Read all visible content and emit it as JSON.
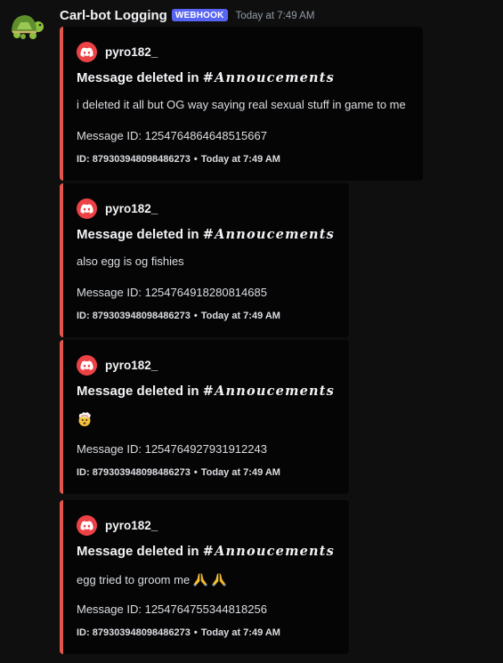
{
  "message": {
    "author": "Carl-bot Logging",
    "badge": "WEBHOOK",
    "timestamp": "Today at 7:49 AM",
    "avatar_icon": "turtle-avatar-icon"
  },
  "accent_color": "#e2574c",
  "embeds": [
    {
      "author": "pyro182_",
      "title_prefix": "Message deleted in ",
      "channel": "#𝑨𝒏𝒏𝒐𝒖𝒄𝒆𝒎𝒆𝒏𝒕𝒔",
      "description": "i deleted it all but OG way saying real sexual stuff in game to me",
      "emojis": [],
      "message_id_text": "Message ID: 1254764864648515667",
      "footer_id": "ID: 879303948098486273",
      "footer_sep": "•",
      "footer_time": "Today at 7:49 AM"
    },
    {
      "author": "pyro182_",
      "title_prefix": "Message deleted in ",
      "channel": "#𝑨𝒏𝒏𝒐𝒖𝒄𝒆𝒎𝒆𝒏𝒕𝒔",
      "description": "also egg is og fishies",
      "emojis": [],
      "message_id_text": "Message ID: 1254764918280814685",
      "footer_id": "ID: 879303948098486273",
      "footer_sep": "•",
      "footer_time": "Today at 7:49 AM"
    },
    {
      "author": "pyro182_",
      "title_prefix": "Message deleted in ",
      "channel": "#𝑨𝒏𝒏𝒐𝒖𝒄𝒆𝒎𝒆𝒏𝒕𝒔",
      "description": "",
      "emojis": [
        "exploding-head-emoji"
      ],
      "message_id_text": "Message ID: 1254764927931912243",
      "footer_id": "ID: 879303948098486273",
      "footer_sep": "•",
      "footer_time": "Today at 7:49 AM"
    },
    {
      "author": "pyro182_",
      "title_prefix": "Message deleted in ",
      "channel": "#𝑨𝒏𝒏𝒐𝒖𝒄𝒆𝒎𝒆𝒏𝒕𝒔",
      "description": "egg tried to groom me",
      "emojis": [
        "folded-hands-emoji",
        "folded-hands-emoji"
      ],
      "message_id_text": "Message ID: 1254764755344818256",
      "footer_id": "ID: 879303948098486273",
      "footer_sep": "•",
      "footer_time": "Today at 7:49 AM"
    }
  ]
}
